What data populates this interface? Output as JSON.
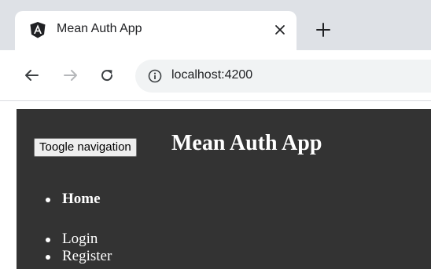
{
  "browser": {
    "tab": {
      "title": "Mean Auth App",
      "favicon": "angular-logo-icon"
    },
    "address_bar": {
      "url": "localhost:4200"
    },
    "icons": {
      "close": "close-icon",
      "new_tab": "plus-icon",
      "back": "arrow-left-icon",
      "forward": "arrow-right-icon",
      "reload": "reload-icon",
      "site_info": "info-icon"
    },
    "colors": {
      "tabstrip": "#dee1e6",
      "tab": "#ffffff",
      "omnibox": "#f1f3f4"
    }
  },
  "navbar": {
    "toggle_label": "Toogle navigation",
    "brand": "Mean Auth App",
    "primary_links": [
      {
        "label": "Home"
      }
    ],
    "secondary_links": [
      {
        "label": "Login"
      },
      {
        "label": "Register"
      }
    ],
    "colors": {
      "background": "#333333",
      "text": "#ffffff"
    }
  }
}
